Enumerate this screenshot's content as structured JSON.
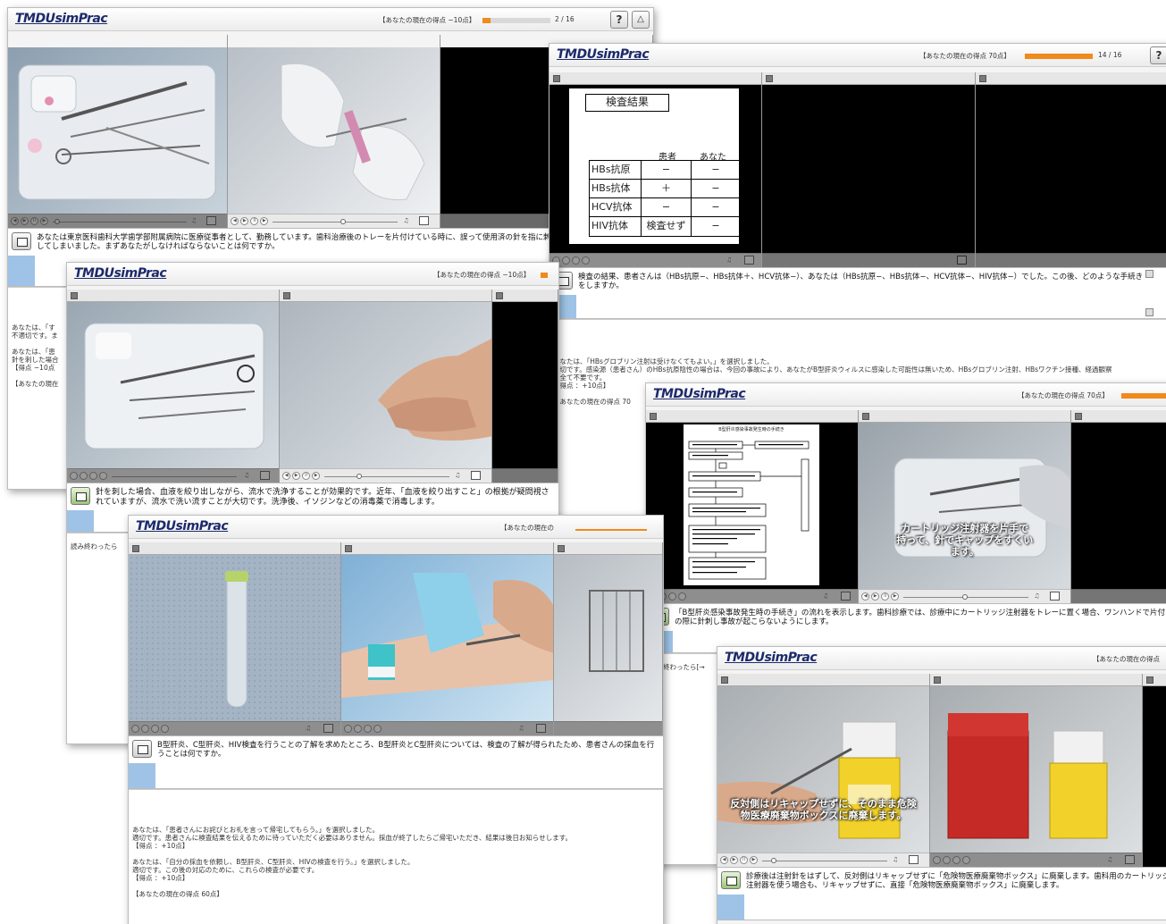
{
  "app": {
    "logo": "TMDUsimPrac",
    "help": "?"
  },
  "windows": {
    "w1": {
      "score": "【あなたの現在の得点 −10点】",
      "progress": "2 / 16",
      "progress_fraction": 0.12,
      "message": "あなたは東京医科歯科大学歯学部附属病院に医療従事者として、勤務しています。歯科治療後のトレーを片付けている時に、誤って使用済の針を指に刺してしまいました。まずあなたがしなければならないことは何ですか。",
      "feedback": "あなたは、「す\n不適切です。ま\n\nあなたは、「患\n針を刺した場合\n【得点 −10点\n\n【あなたの現在"
    },
    "w2": {
      "score": "【あなたの現在の得点 70点】",
      "progress": "14 / 16",
      "progress_fraction": 0.88,
      "test_title": "検査結果",
      "col_patient": "患者",
      "col_you": "あなた",
      "rows": [
        {
          "name": "HBs抗原",
          "patient": "−",
          "you": "−"
        },
        {
          "name": "HBs抗体",
          "patient": "＋",
          "you": "−"
        },
        {
          "name": "HCV抗体",
          "patient": "−",
          "you": "−"
        },
        {
          "name": "HIV抗体",
          "patient": "検査せず",
          "you": "−"
        }
      ],
      "message": "検査の結果、患者さんは（HBs抗原−、HBs抗体＋、HCV抗体−）、あなたは（HBs抗原−、HBs抗体−、HCV抗体−、HIV抗体−）でした。この後、どのような手続きをしますか。",
      "feedback": "あなたは、「HBsグロブリン注射は受けなくてもよい。」を選択しました。\n適切です。感染源（患者さん）のHBs抗原陰性の場合は、今回の事故により、あなたがB型肝炎ウィルスに感染した可能性は無いため、HBsグロブリン注射、HBsワクチン接種、経過観察\nは全て不要です。\n【得点 ：+10点】\n\n【あなたの現在の得点 70"
    },
    "w3": {
      "score": "【あなたの現在の得点 −10点】",
      "message": "針を刺した場合、血液を絞り出しながら、流水で洗浄することが効果的です。近年、「血液を絞り出すこと」の根拠が疑問視されていますが、流水で洗い流すことが大切です。洗浄後、イソジンなどの消毒薬で消毒します。",
      "feedback": "読み終わったら"
    },
    "w4": {
      "score": "【あなたの現在の得点 70点】",
      "flow_title": "B型肝炎感染事故発生時の手続き",
      "caption": "カートリッジ注射器を片手で\n持って、針でキャップをすくい\nます。",
      "message": "「B型肝炎感染事故発生時の手続き」の流れを表示します。歯科診療では、診療中にカートリッジ注射器をトレーに置く場合、ワンハンドで片付けの際に針刺し事故が起こらないようにします。",
      "feedback": "読み終わったら[→"
    },
    "w5": {
      "score": "【あなたの現在の",
      "message": "B型肝炎、C型肝炎、HIV検査を行うことの了解を求めたところ、B型肝炎とC型肝炎については、検査の了解が得られたため、患者さんの採血を行うことは何ですか。",
      "feedback": "あなたは、「患者さんにお詫びとお礼を言って帰宅してもらう。」を選択しました。\n適切です。患者さんに検査結果を伝えるために待っていただく必要はありません。採血が終了したらご帰宅いただき、結果は後日お知らせします。\n【得点 ：+10点】\n\nあなたは、「自分の採血を依頼し、B型肝炎、C型肝炎、HIVの検査を行う。」を選択しました。\n適切です。この後の対応のために、これらの検査が必要です。\n【得点 ：+10点】\n\n【あなたの現在の得点 60点】"
    },
    "w6": {
      "score": "【あなたの現在の得点",
      "caption": "反対側はリキャップせずに、そのまま危険\n物医療廃棄物ボックスに廃棄します。",
      "message": "診療後は注射針をはずして、反対側はリキャップせずに「危険物医療廃棄物ボックス」に廃棄します。歯科用のカートリッジ注射器を使う場合も、リキャップせずに、直接「危険物医療廃棄物ボックス」に廃棄します。"
    }
  }
}
